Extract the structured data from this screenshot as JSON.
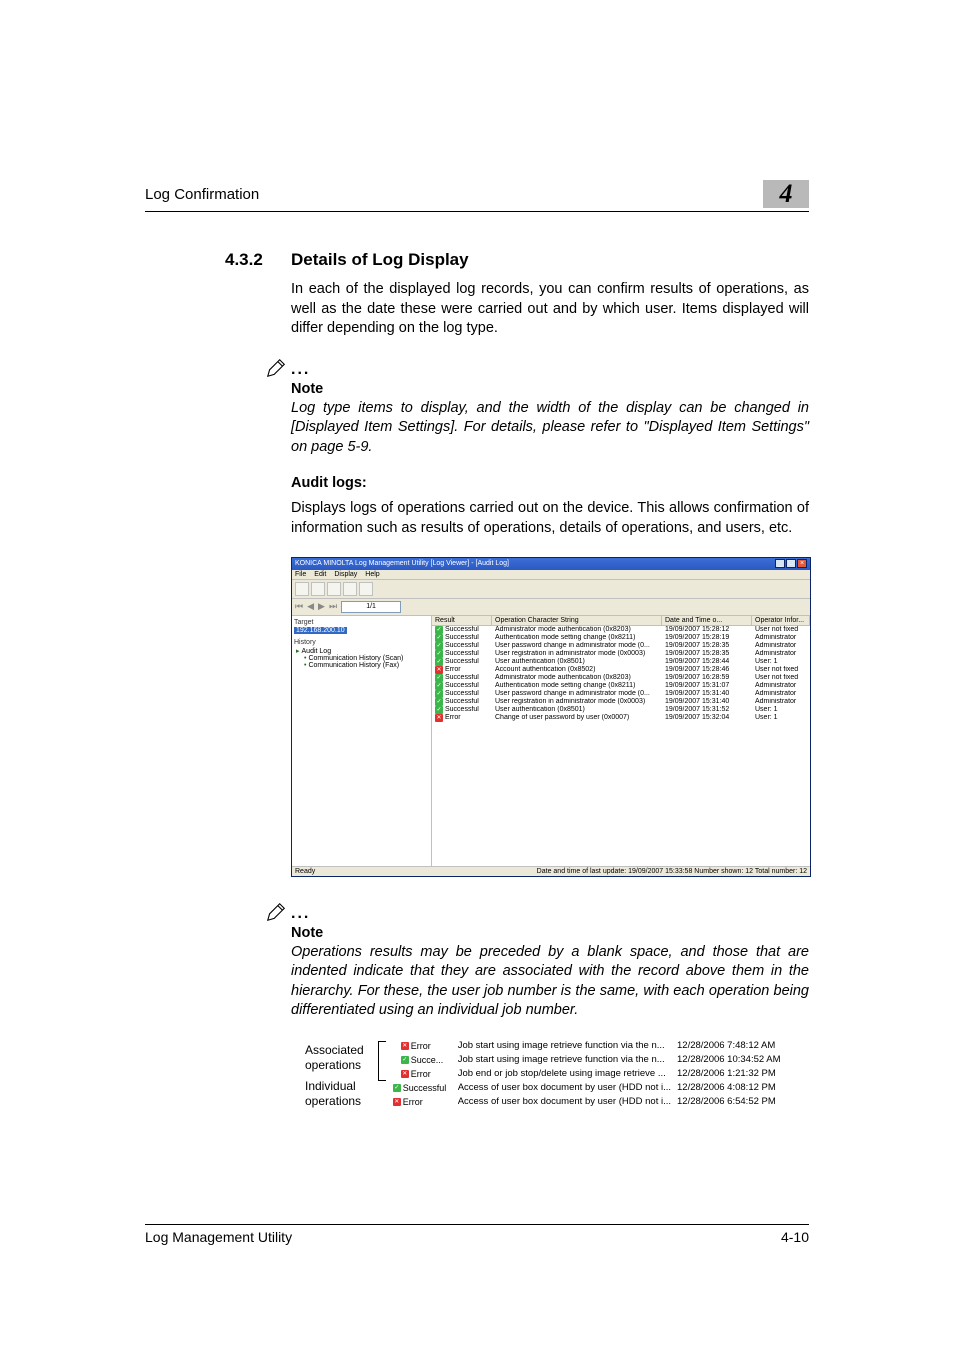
{
  "header": {
    "title": "Log Confirmation",
    "chapter": "4"
  },
  "section": {
    "num": "4.3.2",
    "title": "Details of Log Display"
  },
  "intro": "In each of the displayed log records, you can confirm results of operations, as well as the date these were carried out and by which user. Items displayed will differ depending on the log type.",
  "note1": {
    "label": "Note",
    "body": "Log type items to display, and the width of the display can be changed in [Displayed Item Settings]. For details, please refer to \"Displayed Item Settings\" on page 5-9."
  },
  "audit_head": "Audit logs:",
  "audit_body": "Displays logs of operations carried out on the device. This allows confirmation of information such as results of operations, details of operations, and users, etc.",
  "win": {
    "title": "KONICA MINOLTA Log Management Utility [Log Viewer] - [Audit Log]",
    "menu": [
      "File",
      "Edit",
      "Display",
      "Help"
    ],
    "nav_page": "1/1",
    "left": {
      "target_label": "Target",
      "selected": "192.168.200.10",
      "history_label": "History",
      "tree": [
        "Audit Log",
        "Communication History (Scan)",
        "Communication History (Fax)"
      ]
    },
    "grid": {
      "cols": {
        "result": "Result",
        "op": "Operation Character String",
        "dt": "Date and Time o...",
        "oi": "Operator Infor..."
      },
      "rows": [
        {
          "r": "Successful",
          "ok": true,
          "op": "Administrator mode authentication (0x8203)",
          "dt": "19/09/2007 15:28:12",
          "oi": "User not fixed"
        },
        {
          "r": "Successful",
          "ok": true,
          "op": "Authentication mode setting change (0x8211)",
          "dt": "19/09/2007 15:28:19",
          "oi": "Administrator"
        },
        {
          "r": "Successful",
          "ok": true,
          "op": "User password change in administrator mode (0...",
          "dt": "19/09/2007 15:28:35",
          "oi": "Administrator"
        },
        {
          "r": "Successful",
          "ok": true,
          "op": "User registration in administrator mode (0x0003)",
          "dt": "19/09/2007 15:28:35",
          "oi": "Administrator"
        },
        {
          "r": "Successful",
          "ok": true,
          "op": "User authentication (0x8501)",
          "dt": "19/09/2007 15:28:44",
          "oi": "User: 1"
        },
        {
          "r": "Error",
          "ok": false,
          "op": "Account authentication (0x8502)",
          "dt": "19/09/2007 15:28:46",
          "oi": "User not fixed"
        },
        {
          "r": "Successful",
          "ok": true,
          "op": "Administrator mode authentication (0x8203)",
          "dt": "19/09/2007 16:28:59",
          "oi": "User not fixed"
        },
        {
          "r": "Successful",
          "ok": true,
          "op": "Authentication mode setting change (0x8211)",
          "dt": "19/09/2007 15:31:07",
          "oi": "Administrator"
        },
        {
          "r": "Successful",
          "ok": true,
          "op": "User password change in administrator mode (0...",
          "dt": "19/09/2007 15:31:40",
          "oi": "Administrator"
        },
        {
          "r": "Successful",
          "ok": true,
          "op": "User registration in administrator mode (0x0003)",
          "dt": "19/09/2007 15:31:40",
          "oi": "Administrator"
        },
        {
          "r": "Successful",
          "ok": true,
          "op": "User authentication (0x8501)",
          "dt": "19/09/2007 15:31:52",
          "oi": "User: 1"
        },
        {
          "r": "Error",
          "ok": false,
          "op": "Change of user password by user (0x0007)",
          "dt": "19/09/2007 15:32:04",
          "oi": "User: 1"
        }
      ]
    },
    "status_left": "Ready",
    "status_right": "Date and time of last update: 19/09/2007 15:33:58  Number shown: 12  Total number: 12"
  },
  "note2": {
    "label": "Note",
    "body": "Operations results may be preceded by a blank space, and those that are indented indicate that they are associated with the record above them in the hierarchy. For these, the user job number is the same, with each operation being differentiated using an individual job number."
  },
  "assoc": {
    "l1": "Associated operations",
    "l2": "Individual operations",
    "rows": [
      {
        "r": "Error",
        "ok": false,
        "d": "Job start using image retrieve function via the n...",
        "t": "12/28/2006 7:48:12 AM"
      },
      {
        "r": "Succe...",
        "ok": true,
        "d": "Job start using image retrieve function via the n...",
        "t": "12/28/2006 10:34:52 AM"
      },
      {
        "r": "Error",
        "ok": false,
        "d": "Job end or job stop/delete using image retrieve ...",
        "t": "12/28/2006 1:21:32 PM"
      },
      {
        "r": "Successful",
        "ok": true,
        "d": "Access of user box document by user (HDD not i...",
        "t": "12/28/2006 4:08:12 PM"
      },
      {
        "r": "Error",
        "ok": false,
        "d": "Access of user box document by user (HDD not i...",
        "t": "12/28/2006 6:54:52 PM"
      }
    ]
  },
  "footer": {
    "left": "Log Management Utility",
    "right": "4-10"
  }
}
